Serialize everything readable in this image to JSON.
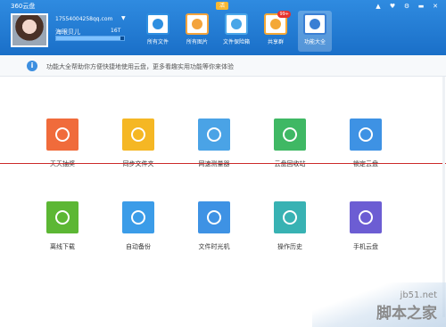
{
  "app": {
    "title": "360云盘",
    "badge": "活"
  },
  "window_controls": [
    "▲",
    "♥",
    "⚙",
    "▬",
    "✕"
  ],
  "user": {
    "account": "17554004258qq.com",
    "nickname": "海眼贝儿",
    "capacity": "16T",
    "usage_percent": 95
  },
  "toolbar": [
    {
      "label": "所有文件",
      "icon": "cloud-files-icon",
      "color": "#2e8fe0"
    },
    {
      "label": "所有图片",
      "icon": "photos-icon",
      "color": "#f3a33c"
    },
    {
      "label": "文件保险箱",
      "icon": "safe-icon",
      "color": "#4aa6e8"
    },
    {
      "label": "共享群",
      "icon": "share-group-icon",
      "color": "#f4a836",
      "badge": "99+"
    },
    {
      "label": "功能大全",
      "icon": "toolbox-icon",
      "color": "#3a7fd4"
    }
  ],
  "info": {
    "text": "功能大全帮助你方便快捷地使用云盘，更多看趣实用功能等你来体验"
  },
  "tiles": [
    {
      "label": "天天抽奖",
      "icon": "gift-icon",
      "color": "#f06b3b"
    },
    {
      "label": "同步文件夹",
      "icon": "sync-folder-icon",
      "color": "#f5b724"
    },
    {
      "label": "网速测量器",
      "icon": "speedometer-icon",
      "color": "#4aa3e6"
    },
    {
      "label": "云盘回收站",
      "icon": "recycle-bin-icon",
      "color": "#3fb864"
    },
    {
      "label": "锁定云盘",
      "icon": "lock-cloud-icon",
      "color": "#3e92e4"
    },
    {
      "label": "离线下载",
      "icon": "download-icon",
      "color": "#5cb734"
    },
    {
      "label": "自动备份",
      "icon": "auto-backup-icon",
      "color": "#3b9ce8"
    },
    {
      "label": "文件时光机",
      "icon": "time-machine-icon",
      "color": "#3e92e4"
    },
    {
      "label": "操作历史",
      "icon": "history-icon",
      "color": "#38b2b3"
    },
    {
      "label": "手机云盘",
      "icon": "mobile-cloud-icon",
      "color": "#6c5dd3"
    }
  ],
  "watermark": {
    "site": "jb51.net",
    "name": "脚本之家"
  }
}
